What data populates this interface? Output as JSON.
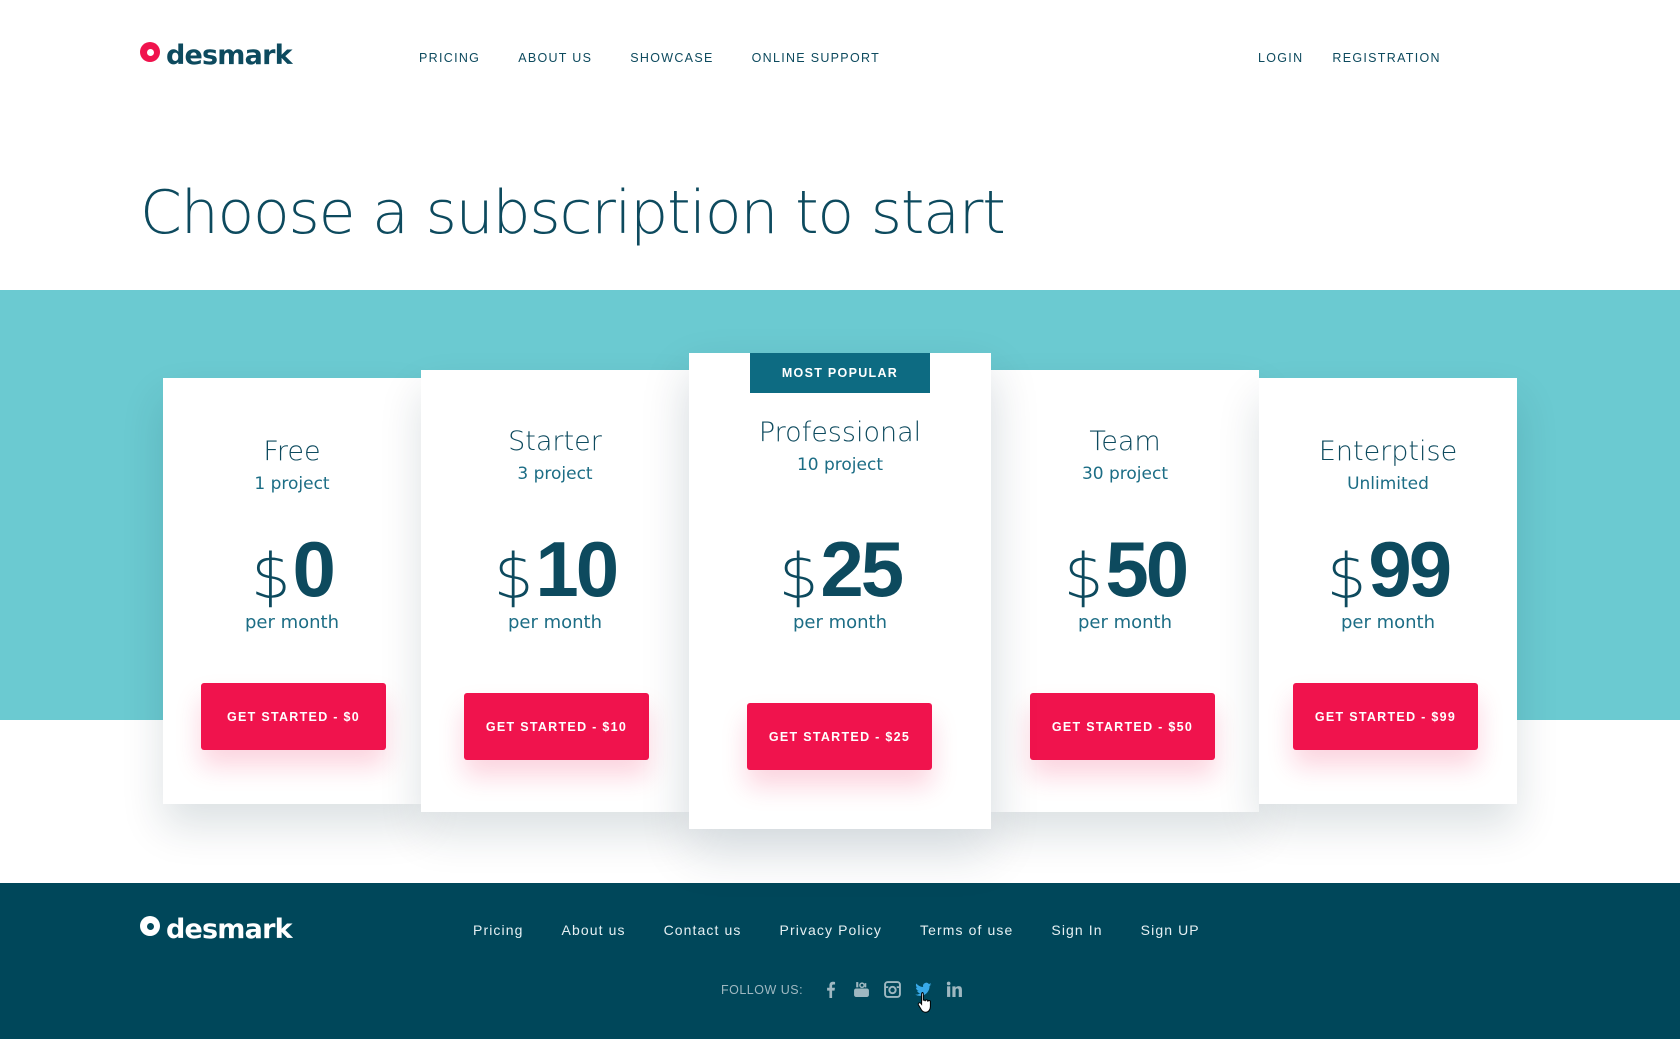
{
  "brand": {
    "name": "desmark",
    "accent_color": "#f0134d",
    "primary_color": "#0d4a5e"
  },
  "nav": {
    "items": [
      {
        "label": "PRICING"
      },
      {
        "label": "ABOUT US"
      },
      {
        "label": "SHOWCASE"
      },
      {
        "label": "ONLINE SUPPORT"
      }
    ],
    "login": "LOGIN",
    "registration": "REGISTRATION"
  },
  "headline": "Choose a subscription to start",
  "band_color": "#6bcad1",
  "plans": [
    {
      "name": "Free",
      "projects": "1 project",
      "currency": "$",
      "price": "0",
      "period": "per month",
      "cta": "GET STARTED - $0",
      "featured": false
    },
    {
      "name": "Starter",
      "projects": "3 project",
      "currency": "$",
      "price": "10",
      "period": "per month",
      "cta": "GET STARTED - $10",
      "featured": false
    },
    {
      "name": "Professional",
      "projects": "10 project",
      "currency": "$",
      "price": "25",
      "period": "per month",
      "cta": "GET STARTED - $25",
      "featured": true,
      "badge": "MOST POPULAR"
    },
    {
      "name": "Team",
      "projects": "30 project",
      "currency": "$",
      "price": "50",
      "period": "per month",
      "cta": "GET STARTED - $50",
      "featured": false
    },
    {
      "name": "Enterptise",
      "projects": "Unlimited",
      "currency": "$",
      "price": "99",
      "period": "per month",
      "cta": "GET STARTED - $99",
      "featured": false
    }
  ],
  "footer": {
    "links": [
      {
        "label": "Pricing"
      },
      {
        "label": "About us"
      },
      {
        "label": "Contact us"
      },
      {
        "label": "Privacy Policy"
      },
      {
        "label": "Terms of use"
      },
      {
        "label": "Sign In"
      },
      {
        "label": "Sign UP"
      }
    ],
    "follow_label": "FOLLOW US:",
    "social": [
      {
        "icon": "facebook-icon"
      },
      {
        "icon": "youtube-icon"
      },
      {
        "icon": "instagram-icon"
      },
      {
        "icon": "twitter-icon",
        "active": true
      },
      {
        "icon": "linkedin-icon"
      }
    ],
    "color": "#00475a"
  }
}
